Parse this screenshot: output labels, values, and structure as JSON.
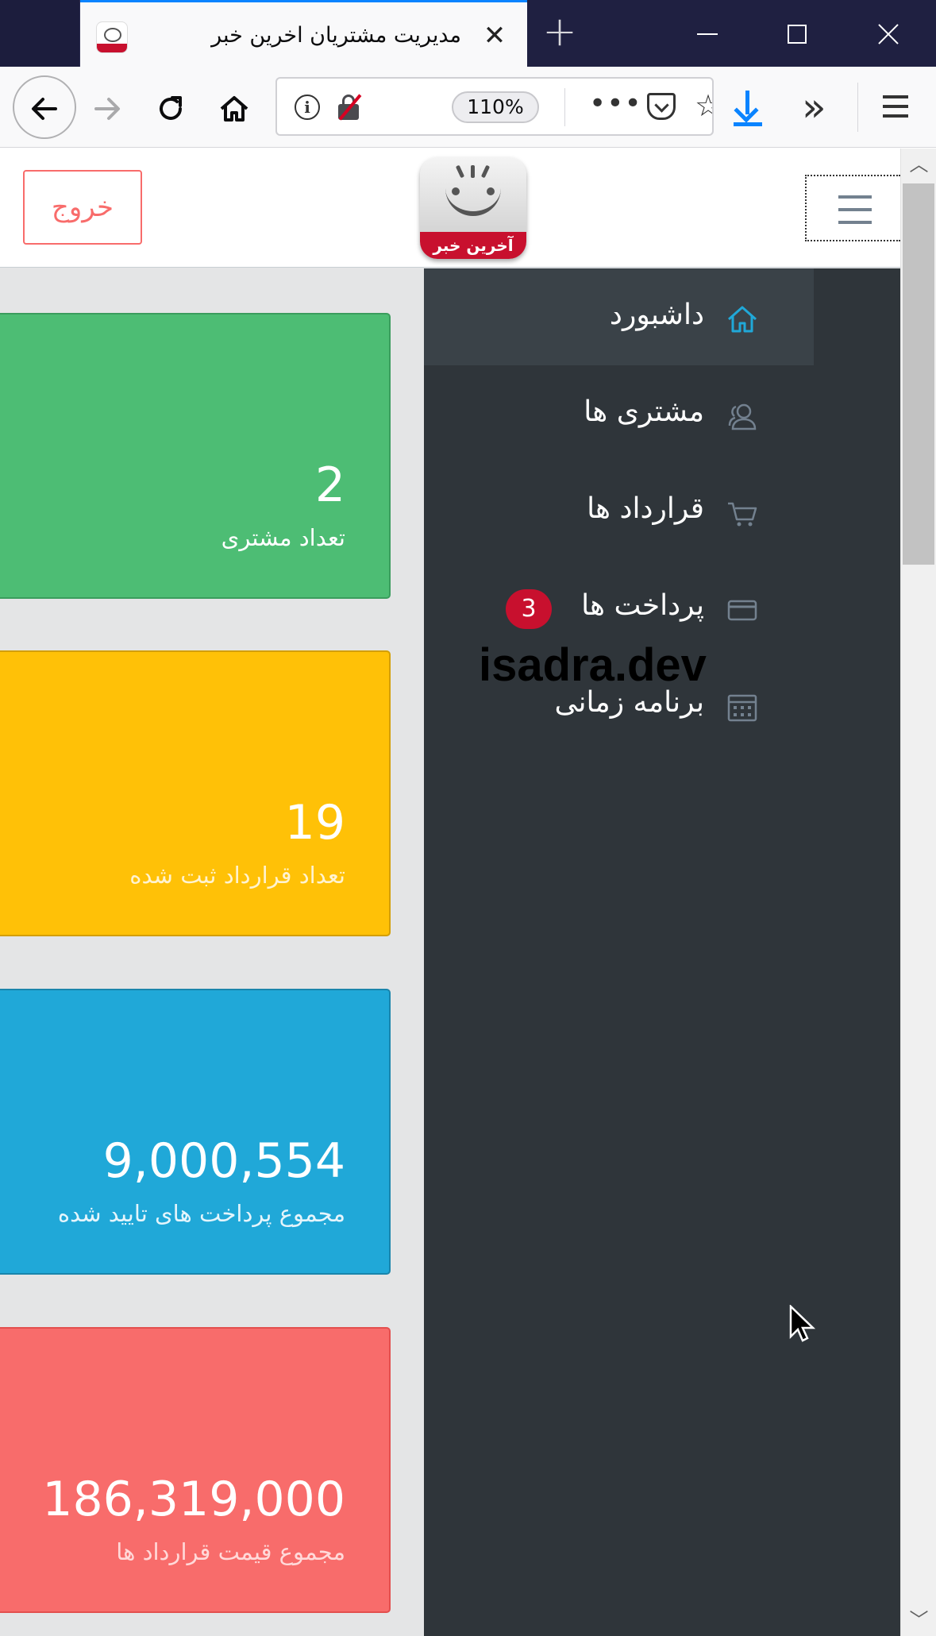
{
  "browser": {
    "tab_title": "مدیریت مشتریان اخرین خبر",
    "zoom": "110%",
    "tab_close_glyph": "✕",
    "new_tab_glyph": "+"
  },
  "header": {
    "logout_label": "خروج",
    "logo_text": "آخرین خبر"
  },
  "sidebar": {
    "items": [
      {
        "label": "داشبورد",
        "icon": "home-icon",
        "active": true
      },
      {
        "label": "مشتری ها",
        "icon": "user-icon"
      },
      {
        "label": "قرارداد ها",
        "icon": "cart-icon"
      },
      {
        "label": "پرداخت ها",
        "icon": "credit-card-icon",
        "badge": "3"
      },
      {
        "label": "برنامه زمانی",
        "icon": "calendar-icon"
      }
    ]
  },
  "watermark": "isadra.dev",
  "cards": [
    {
      "value": "2",
      "caption": "تعداد مشتری",
      "color": "#4dbd74",
      "caption_color": "#ffffff"
    },
    {
      "value": "19",
      "caption": "تعداد قرارداد ثبت شده",
      "color": "#ffc107",
      "caption_color": "#fff3d0"
    },
    {
      "value": "9,000,554",
      "caption": "مجموع پرداخت های تایید شده",
      "color": "#20a8d8",
      "caption_color": "#e4f5fc"
    },
    {
      "value": "186,319,000",
      "caption": "مجموع قیمت قرارداد ها",
      "color": "#f86c6b",
      "caption_color": "#ffd9d9"
    }
  ],
  "colors": {
    "accent": "#0a84ff",
    "sidebar_bg": "#2f353a",
    "active_icon": "#20a8d8",
    "badge": "#c8102e"
  }
}
